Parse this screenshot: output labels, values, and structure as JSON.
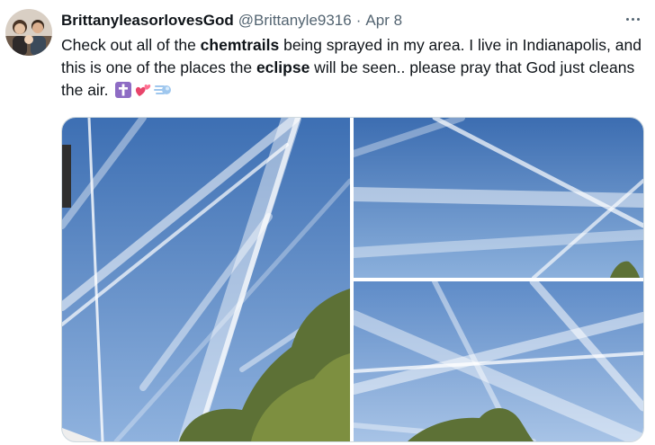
{
  "tweet": {
    "display_name": "BrittanyleasorlovesGod",
    "handle": "@Brittanyle9316",
    "separator": "·",
    "date": "Apr 8",
    "text": {
      "p1": "Check out all of the ",
      "b1": "chemtrails",
      "p2": " being sprayed in my area. I live in Indianapolis, and this is one of the places the ",
      "b2": "eclipse",
      "p3": " will be seen.. please pray that God just cleans the air."
    },
    "emojis": [
      "cross-emoji",
      "two-hearts-emoji",
      "dash-emoji"
    ],
    "media": [
      {
        "icon": "sky-contrails-photo-left"
      },
      {
        "icon": "sky-contrails-photo-top-right"
      },
      {
        "icon": "sky-contrails-photo-bottom-right"
      }
    ]
  },
  "colors": {
    "text": "#0f1419",
    "secondary": "#536471",
    "border": "#cfd9de",
    "sky_top": "#3d6fb3",
    "sky_bottom": "#8fb2de",
    "foliage": "#5d7136",
    "cross_emoji_bg": "#8e6cc4"
  }
}
